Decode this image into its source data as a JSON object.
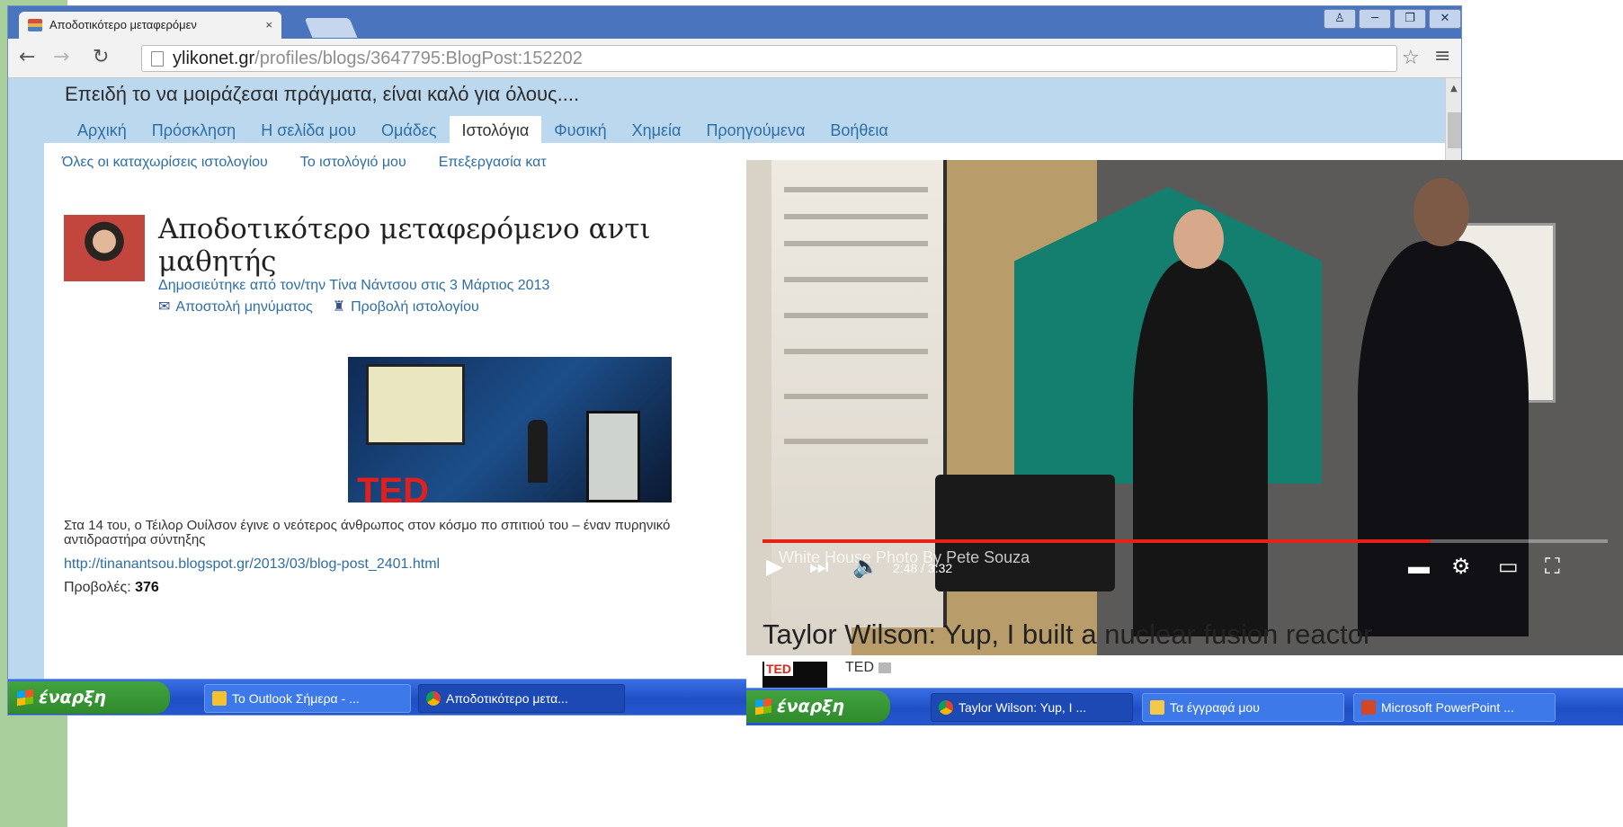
{
  "browser": {
    "tab_title": "Αποδοτικότερο μεταφερόμεν",
    "tab_close": "×",
    "url_host": "ylikonet.gr",
    "url_path": "/profiles/blogs/3647795:BlogPost:152202",
    "window_buttons": [
      "♙",
      "─",
      "❐",
      "✕"
    ]
  },
  "site": {
    "tagline": "Επειδή το να μοιράζεσαι πράγματα, είναι καλό για όλους....",
    "nav": [
      "Αρχική",
      "Πρόσκληση",
      "Η σελίδα μου",
      "Ομάδες",
      "Ιστολόγια",
      "Φυσική",
      "Χημεία",
      "Προηγούμενα",
      "Βοήθεια"
    ],
    "active_nav": "Ιστολόγια",
    "subnav": [
      "Όλες οι καταχωρίσεις ιστολογίου",
      "Το ιστολόγιό μου",
      "Επεξεργασία κατ"
    ]
  },
  "post": {
    "title": "Αποδοτικότερο μεταφερόμενο αντι μαθητής",
    "byline": "Δημοσιεύτηκε από τον/την Τίνα Νάντσου στις 3 Μάρτιος 2013",
    "send_message": "Αποστολή μηνύματος",
    "view_blog": "Προβολή ιστολογίου",
    "image_logo": "TED",
    "excerpt": "Στα 14 του, ο Τέιλορ Ουίλσον έγινε ο νεότερος άνθρωπος στον κόσμο πο σπιτιού του – έναν πυρηνικό αντιδραστήρα σύντηξης",
    "link": "http://tinanantsou.blogspot.gr/2013/03/blog-post_2401.html",
    "views_label": "Προβολές:",
    "views_count": "376"
  },
  "taskbar1": {
    "start": "έναρξη",
    "items": [
      "Το Outlook Σήμερα - ...",
      "Αποδοτικότερο μετα..."
    ]
  },
  "video": {
    "watermark": "White House Photo By Pete Souza",
    "current_time": "2:48",
    "duration": "3:32",
    "progress": 0.79,
    "title": "Taylor Wilson: Yup, I built a nuclear fusion reactor",
    "channel": "TED",
    "channel_logo": "TED"
  },
  "taskbar2": {
    "start": "έναρξη",
    "items": [
      "Taylor Wilson: Yup, I ...",
      "Τα έγγραφά μου",
      "Microsoft PowerPoint ..."
    ]
  }
}
